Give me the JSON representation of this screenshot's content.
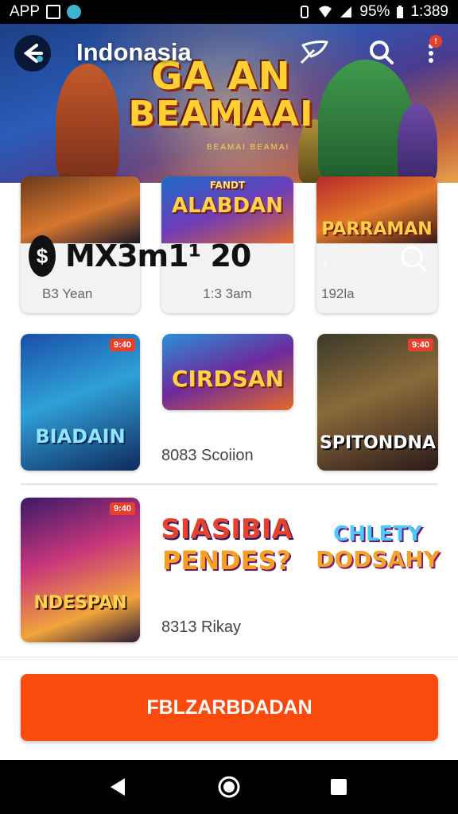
{
  "status_bar": {
    "app_label": "APP",
    "battery_text": "95%",
    "time": "1:389"
  },
  "header": {
    "title": "Indonasia",
    "notification_count": "!",
    "banner_line1": "GA  AN",
    "banner_line2": "BEAMAAI",
    "banner_sub": "BEAMAI BEAMAI"
  },
  "row1": {
    "card1": {
      "art_label": "",
      "meta": "B3 Yean"
    },
    "card2": {
      "art_label": "ALABDAN",
      "art_sublabel": "FANDT",
      "meta": "1:3 3am"
    },
    "card3": {
      "art_label": "PARRAMAN",
      "meta": "192la"
    },
    "price_icon": "$",
    "price_text": "MX3m1¹ 20"
  },
  "row2": {
    "card1": {
      "tag": "9:40",
      "art_label": "BIADAIN"
    },
    "card2": {
      "art_label": "CIRDSAN"
    },
    "card3": {
      "tag": "9:40",
      "art_label": "SPITONDNA"
    },
    "caption": "8083 Scoiion"
  },
  "row3": {
    "card1": {
      "tag": "9:40",
      "art_label": "NDESPAN"
    },
    "logo2_line1": "SIASIBIA",
    "logo2_line2": "PENDES?",
    "logo3_line1": "CHLETY",
    "logo3_line2": "DODSAHY",
    "caption": "8313 Rikay"
  },
  "cta": {
    "label": "FBLZARBDADAN"
  },
  "colors": {
    "accent": "#fb4a0e",
    "badge": "#e8412b"
  },
  "icons": [
    "back-arrow-icon",
    "feather-icon",
    "search-icon",
    "more-vert-icon",
    "nav-back-icon",
    "nav-home-icon",
    "nav-recent-icon"
  ]
}
